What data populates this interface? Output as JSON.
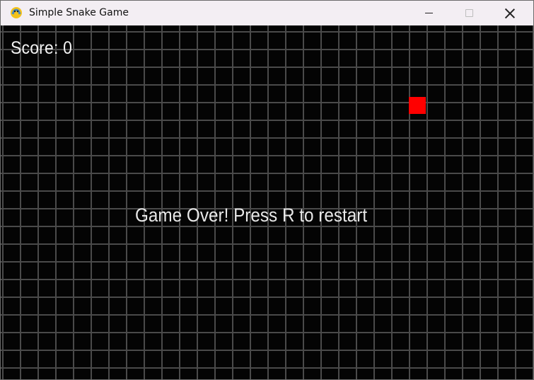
{
  "window": {
    "title": "Simple Snake Game",
    "icon": "pygame-snake-icon"
  },
  "game": {
    "score_text": "Score: 0",
    "game_over_text": "Game Over! Press R to restart",
    "food_color": "#ff0000",
    "background_color": "#040404",
    "grid_color": "#4a4a4a"
  }
}
